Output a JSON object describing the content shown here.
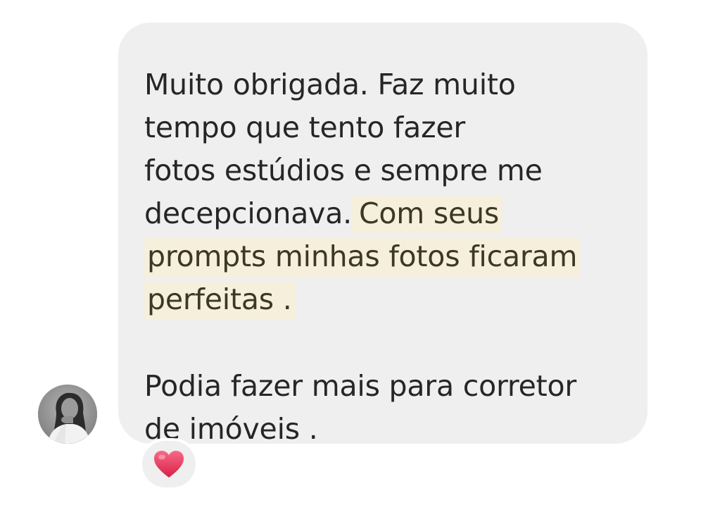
{
  "message": {
    "lines": [
      "Muito obrigada. Faz muito",
      "tempo que tento fazer",
      "fotos estúdios e sempre me",
      "decepcionava.",
      "perfeitas ."
    ],
    "highlight": {
      "part1": "Com seus",
      "part2": "prompts minhas fotos ficaram",
      "part3": "perfeitas ."
    },
    "second_paragraph": [
      "Podia fazer mais para corretor",
      "de imóveis ."
    ]
  },
  "reaction": {
    "icon": "heart-icon",
    "color": "#e8335a"
  },
  "colors": {
    "bubble": "#efefef",
    "highlight": "#f5efdc",
    "text": "#262626"
  }
}
